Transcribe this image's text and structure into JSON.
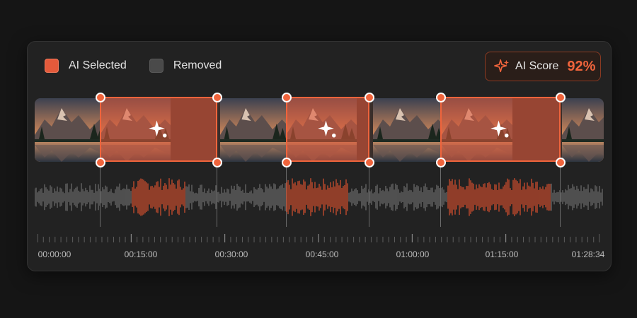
{
  "legend": {
    "selected_label": "AI Selected",
    "removed_label": "Removed"
  },
  "score": {
    "label": "AI Score",
    "value": "92%",
    "icon": "sparkle-icon"
  },
  "colors": {
    "accent": "#f0643c",
    "selected": "#e45a3b",
    "removed": "#4a4a4a",
    "background": "#151515",
    "panel": "#222222",
    "waveform_removed": "#6e6e6e",
    "waveform_selected": "#d9502e"
  },
  "selections_icon": "sparkle-icon",
  "timeline": {
    "labels": [
      "00:00:00",
      "00:15:00",
      "00:30:00",
      "00:45:00",
      "01:00:00",
      "01:15:00",
      "01:28:34"
    ]
  }
}
